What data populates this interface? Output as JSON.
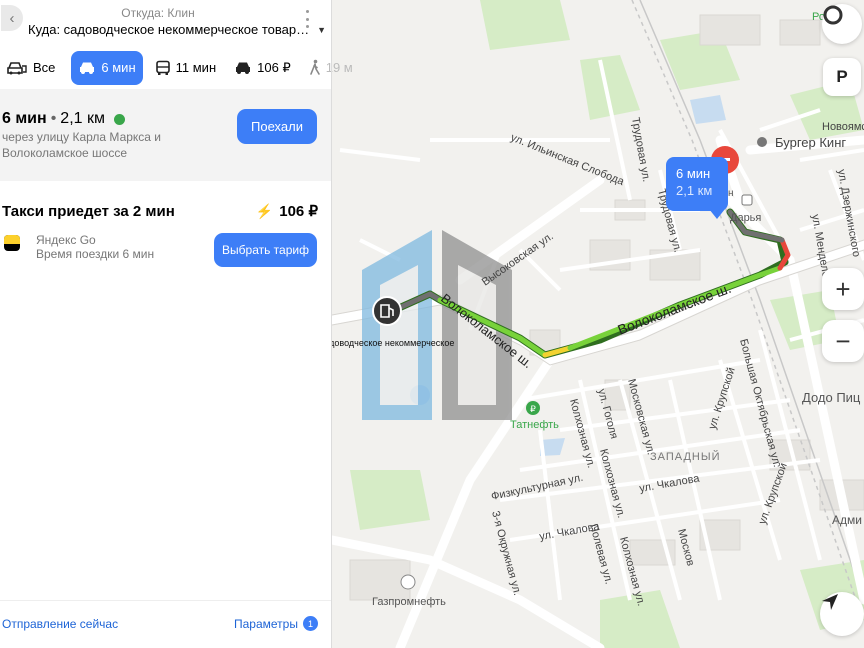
{
  "header": {
    "from_label": "Откуда: Клин",
    "to_label": "Куда: садоводческое некоммерческое товар…"
  },
  "modes": [
    {
      "label": "Все",
      "icon": "car-icon"
    },
    {
      "label": "6 мин",
      "icon": "car-icon",
      "active": true
    },
    {
      "label": "11 мин",
      "icon": "bus-icon"
    },
    {
      "label": "106 ₽",
      "icon": "taxi-icon"
    },
    {
      "label": "19 м",
      "icon": "walk-icon"
    }
  ],
  "route": {
    "time": "6 мин",
    "separator": "•",
    "distance": "2,1 км",
    "via": "через улицу Карла Маркса и Волоколамское шоссе",
    "go_label": "Поехали"
  },
  "taxi": {
    "title": "Такси приедет за 2 мин",
    "price": "106 ₽",
    "service": "Яндекс Go",
    "trip_time": "Время поездки 6 мин",
    "tariff_label": "Выбрать тариф"
  },
  "footer": {
    "depart": "Отправление сейчас",
    "params": "Параметры",
    "params_count": "1"
  },
  "map": {
    "bubble_time": "6 мин",
    "bubble_distance": "2,1 км",
    "destination_label": "садоводческое некоммерческое",
    "streets": {
      "volokolamskoe": "Волоколамское ш.",
      "volokolamskoe_2": "Волоколамское ш.",
      "vysokovskaya": "Высоковская ул.",
      "ilinskaya": "ул. Ильинская Слобода",
      "trudovaya_1": "Трудовая ул.",
      "trudovaya_2": "Трудовая ул.",
      "novoyamskaya": "Новоямская",
      "dzerzhinskogo": "ул. Дзержинского",
      "mendeleeva": "ул. Менделеева",
      "bolshaya_oktyabrskaya": "Большая Октябрьская ул.",
      "krupskoy_1": "ул. Крупской",
      "krupskoy_2": "ул. Крупской",
      "gogolya": "ул. Гоголя",
      "moskovskaya_1": "Московская ул.",
      "moskovskaya_2": "Москов",
      "kolkhoznaya_1": "Колхозная ул.",
      "kolkhoznaya_2": "Колхозная ул.",
      "kolkhoznaya_3": "Колхозная ул.",
      "fizkulturnaya": "Физкультурная ул.",
      "chkalova_1": "ул. Чкалова",
      "chkalova_2": "ул. Чкалова",
      "okruzhnaya": "3-я Окружная ул.",
      "polevaya": "Полевая ул."
    },
    "district": "ЗАПАДНЫЙ",
    "pois": {
      "burger_king": "Бургер Кинг",
      "tatneft": "Татнефть",
      "gazpromneft": "Газпромнефть",
      "dodo": "Додо Пиц",
      "darya": "Дарья",
      "admin": "Адми",
      "park_top": "Ро",
      "stub_n": "н"
    },
    "parking_label": "P",
    "zoom_in": "+",
    "zoom_out": "−",
    "colors": {
      "route_green": "#78d23a",
      "route_yellow": "#f2d230",
      "route_red": "#e8473b",
      "route_gray": "#707070",
      "accent": "#3d7ef7"
    }
  }
}
